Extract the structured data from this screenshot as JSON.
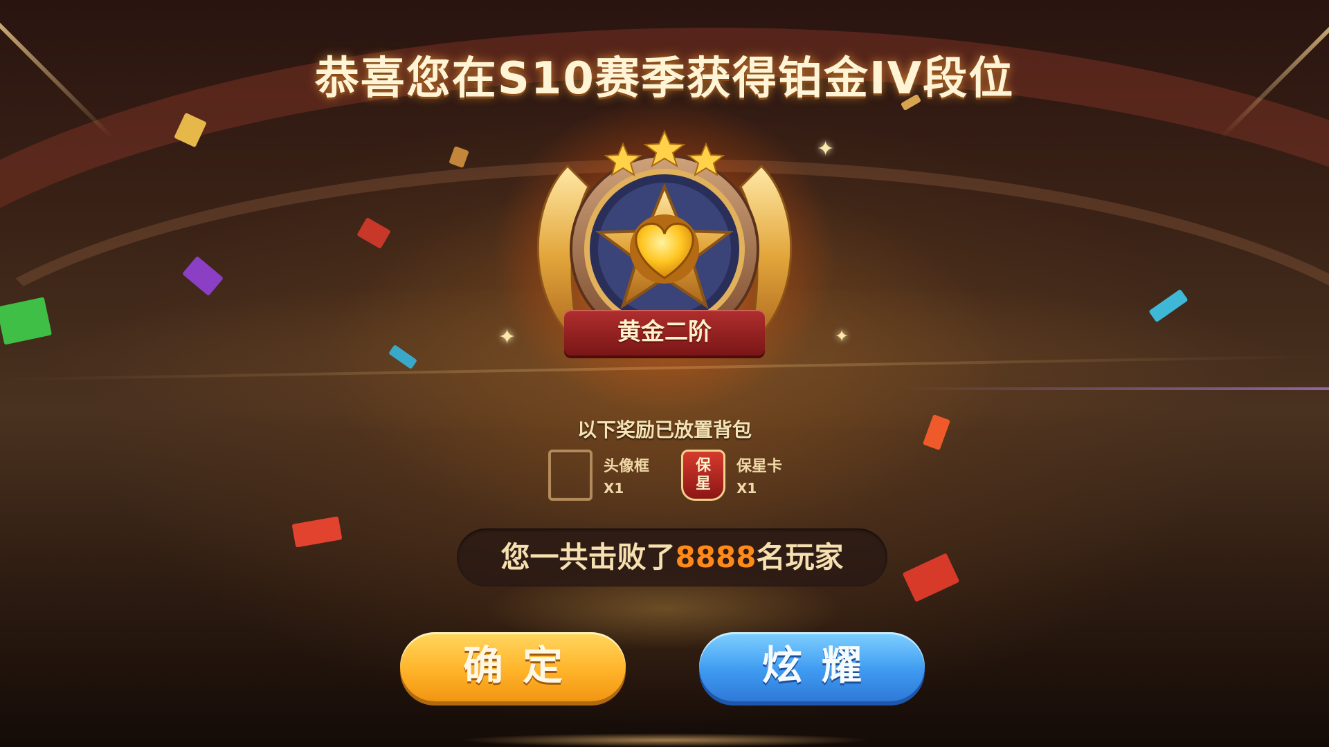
{
  "title": "恭喜您在S10赛季获得铂金IV段位",
  "badge": {
    "rank_name": "黄金二阶",
    "stars": 3
  },
  "rewards": {
    "title": "以下奖励已放置背包",
    "items": [
      {
        "name": "头像框",
        "qty": "X1",
        "icon": "avatar-frame-icon"
      },
      {
        "name": "保星卡",
        "qty": "X1",
        "icon": "star-protect-card-icon",
        "icon_text": "保星"
      }
    ]
  },
  "defeat": {
    "prefix": "您一共击败了",
    "count": "8888",
    "suffix": "名玩家"
  },
  "buttons": {
    "confirm_label": "确定",
    "share_label": "炫耀"
  },
  "colors": {
    "accent_orange": "#ff8a1a",
    "confirm_button": "#ffb42a",
    "share_button": "#3f9bf1",
    "ribbon_red": "#b02e2e"
  }
}
